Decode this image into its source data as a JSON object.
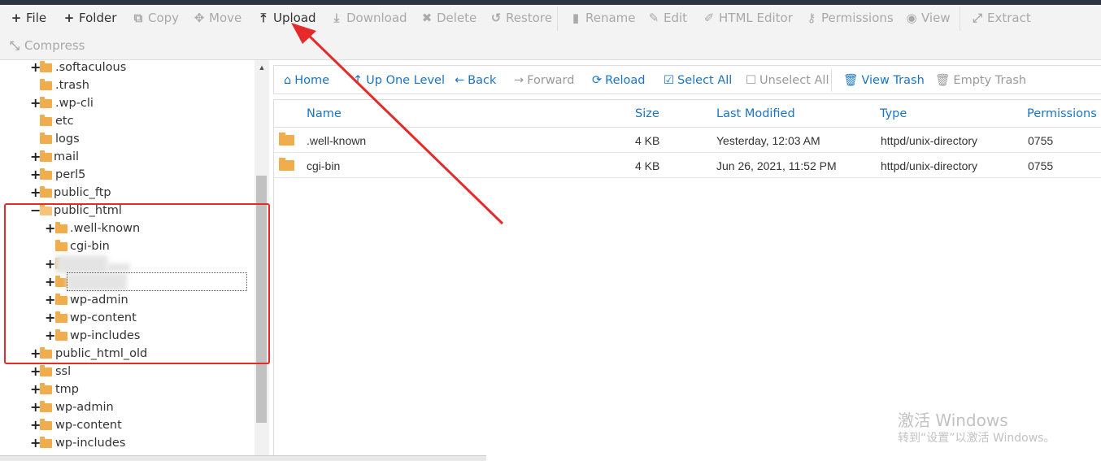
{
  "toolbar": {
    "buttons": [
      {
        "label": "File",
        "icon": "plus-icon",
        "enabled": true
      },
      {
        "label": "Folder",
        "icon": "plus-icon",
        "enabled": true
      },
      {
        "label": "Copy",
        "icon": "copy-icon",
        "enabled": false
      },
      {
        "label": "Move",
        "icon": "move-icon",
        "enabled": false
      },
      {
        "label": "Upload",
        "icon": "upload-icon",
        "enabled": true
      },
      {
        "label": "Download",
        "icon": "download-icon",
        "enabled": false
      },
      {
        "label": "Delete",
        "icon": "delete-icon",
        "enabled": false
      },
      {
        "label": "Restore",
        "icon": "restore-icon",
        "enabled": false
      },
      {
        "label": "Rename",
        "icon": "file-icon",
        "enabled": false
      },
      {
        "label": "Edit",
        "icon": "pencil-icon",
        "enabled": false
      },
      {
        "label": "HTML Editor",
        "icon": "edit-square-icon",
        "enabled": false
      },
      {
        "label": "Permissions",
        "icon": "key-icon",
        "enabled": false
      },
      {
        "label": "View",
        "icon": "eye-icon",
        "enabled": false
      },
      {
        "label": "Extract",
        "icon": "expand-icon",
        "enabled": false
      },
      {
        "label": "Compress",
        "icon": "compress-icon",
        "enabled": false
      }
    ]
  },
  "tree": {
    "items": [
      {
        "label": ".softaculous",
        "expandable": true
      },
      {
        "label": ".trash",
        "expandable": false
      },
      {
        "label": ".wp-cli",
        "expandable": true
      },
      {
        "label": "etc",
        "expandable": false
      },
      {
        "label": "logs",
        "expandable": false
      },
      {
        "label": "mail",
        "expandable": true
      },
      {
        "label": "perl5",
        "expandable": true
      },
      {
        "label": "public_ftp",
        "expandable": true
      },
      {
        "label": "public_html",
        "expandable": true,
        "open": true
      },
      {
        "label": ".well-known",
        "expandable": true
      },
      {
        "label": "cgi-bin",
        "expandable": false
      },
      {
        "label": "",
        "expandable": true
      },
      {
        "label": "",
        "expandable": true
      },
      {
        "label": "wp-admin",
        "expandable": true
      },
      {
        "label": "wp-content",
        "expandable": true
      },
      {
        "label": "wp-includes",
        "expandable": true
      },
      {
        "label": "public_html_old",
        "expandable": true
      },
      {
        "label": "ssl",
        "expandable": true
      },
      {
        "label": "tmp",
        "expandable": true
      },
      {
        "label": "wp-admin",
        "expandable": true
      },
      {
        "label": "wp-content",
        "expandable": true
      },
      {
        "label": "wp-includes",
        "expandable": true
      }
    ]
  },
  "nav": {
    "home": "Home",
    "up": "Up One Level",
    "back": "Back",
    "forward": "Forward",
    "reload": "Reload",
    "select_all": "Select All",
    "unselect_all": "Unselect All",
    "view_trash": "View Trash",
    "empty_trash": "Empty Trash"
  },
  "table": {
    "headers": {
      "name": "Name",
      "size": "Size",
      "modified": "Last Modified",
      "type": "Type",
      "permissions": "Permissions"
    },
    "rows": [
      {
        "name": ".well-known",
        "size": "4 KB",
        "modified": "Yesterday, 12:03 AM",
        "type": "httpd/unix-directory",
        "permissions": "0755"
      },
      {
        "name": "cgi-bin",
        "size": "4 KB",
        "modified": "Jun 26, 2021, 11:52 PM",
        "type": "httpd/unix-directory",
        "permissions": "0755"
      }
    ]
  },
  "watermark": {
    "line1": "激活 Windows",
    "line2": "转到“设置”以激活 Windows。"
  },
  "colors": {
    "link_blue": "#1a73c6",
    "folder_orange": "#f0ad4e",
    "annotation_red": "#e62a2a",
    "topbar": "#2e3540"
  }
}
